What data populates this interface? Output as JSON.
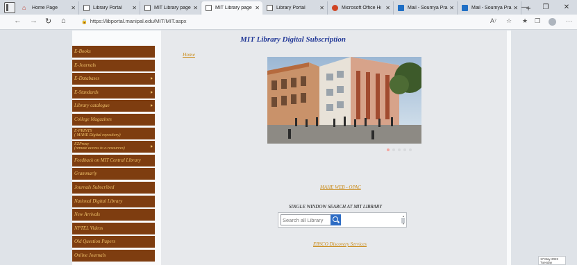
{
  "browser": {
    "tabs": [
      {
        "label": "Home Page",
        "icon": "home-icon",
        "active": false
      },
      {
        "label": "Library Portal",
        "icon": "page-icon",
        "active": false
      },
      {
        "label": "MIT Library page",
        "icon": "page-icon",
        "active": false
      },
      {
        "label": "MIT Library page",
        "icon": "page-icon",
        "active": true
      },
      {
        "label": "Library Portal",
        "icon": "page-icon",
        "active": false
      },
      {
        "label": "Microsoft Office Hi",
        "icon": "office-icon",
        "active": false
      },
      {
        "label": "Mail - Soumya Pra",
        "icon": "mail-icon",
        "active": false
      },
      {
        "label": "Mail - Soumya Pra",
        "icon": "mail-icon",
        "active": false
      }
    ],
    "new_tab": "+",
    "url": "https://libportal.manipal.edu/MIT/MIT.aspx"
  },
  "page": {
    "heading": "MIT Library Digital Subscription",
    "home_link": "Home",
    "menu": [
      {
        "label": "E-Books",
        "arrow": false
      },
      {
        "label": "E-Journals",
        "arrow": false
      },
      {
        "label": "E-Databases",
        "arrow": true
      },
      {
        "label": "E-Standards",
        "arrow": true
      },
      {
        "label": "Library catalogue",
        "arrow": true
      },
      {
        "label": "College Magazines",
        "arrow": false
      },
      {
        "label": "E-PRINTS",
        "sub": "( MAHE Digital repository)",
        "arrow": false
      },
      {
        "label": "EZProxy",
        "sub": "(remote access to e-resources)",
        "arrow": true
      },
      {
        "label": "Feedback on MIT Central Library",
        "arrow": false
      },
      {
        "label": "Grammarly",
        "arrow": false
      },
      {
        "label": "Journals Subscribed",
        "arrow": false
      },
      {
        "label": "National Digital Library",
        "arrow": false
      },
      {
        "label": "New Arrivals",
        "arrow": false
      },
      {
        "label": "NPTEL Videos",
        "arrow": false
      },
      {
        "label": "Old Question Papers",
        "arrow": false
      },
      {
        "label": "Online Journals",
        "arrow": false
      }
    ],
    "opac_link": "MAHE WEB - OPAC",
    "single_window_label": "SINGLE WINDOW SEARCH AT MIT LIBRARY",
    "search_placeholder": "Search all Library",
    "ebsco_link": "EBSCO Discovery Services",
    "carousel": {
      "slides": 5,
      "active": 1
    }
  },
  "taskbar": {
    "date": "17 May 2022",
    "day": "Tuesday"
  },
  "colors": {
    "menu_bg": "#7e3d10",
    "menu_text": "#f0c36b",
    "heading": "#243a98",
    "link": "#c98a17"
  }
}
